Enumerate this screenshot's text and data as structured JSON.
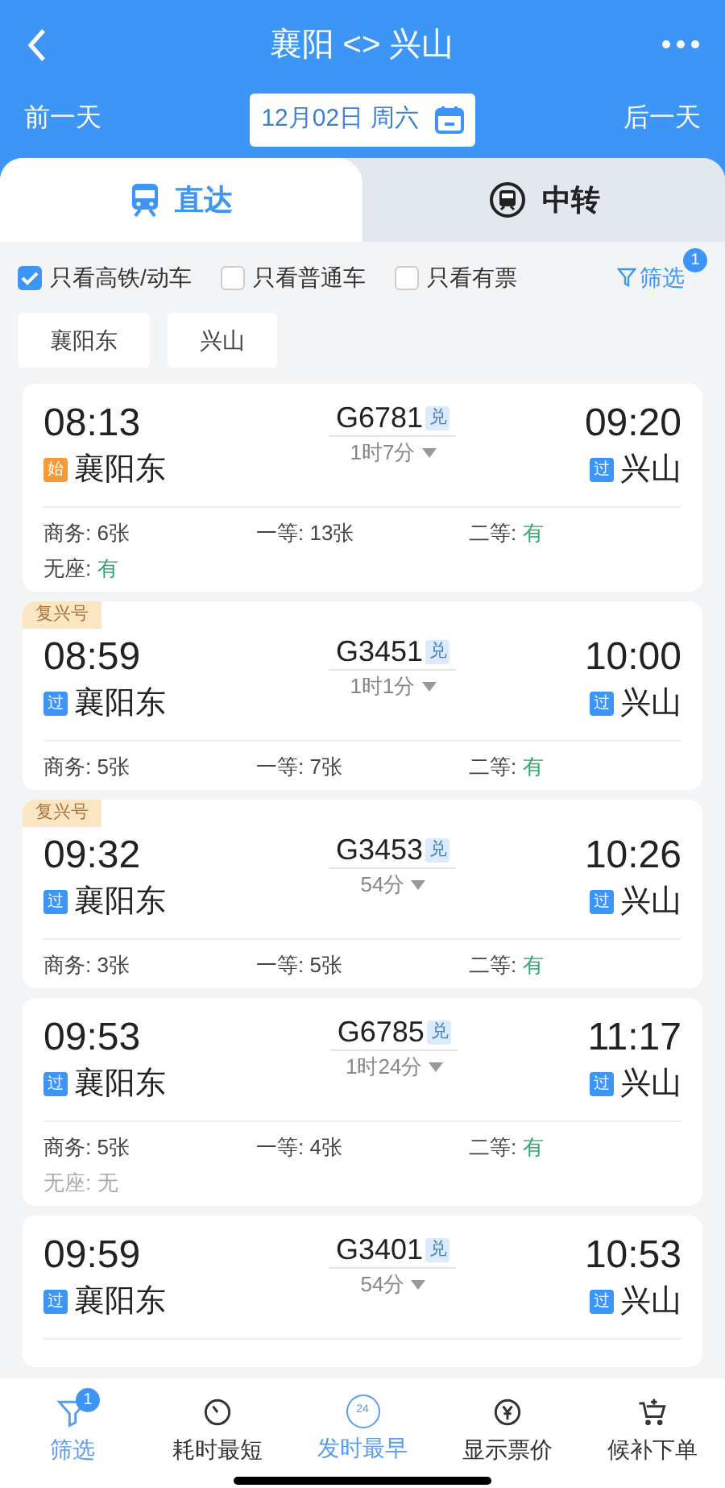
{
  "header": {
    "title": "襄阳 <> 兴山",
    "prev_day": "前一天",
    "date": "12月02日 周六",
    "next_day": "后一天"
  },
  "tabs": [
    {
      "label": "直达",
      "kind": "train",
      "selected": true
    },
    {
      "label": "中转",
      "kind": "transfer",
      "selected": false
    }
  ],
  "filters": [
    {
      "label": "只看高铁/动车",
      "checked": true
    },
    {
      "label": "只看普通车",
      "checked": false
    },
    {
      "label": "只看有票",
      "checked": false
    }
  ],
  "filter_button": {
    "label": "筛选",
    "badge": "1"
  },
  "station_chips": [
    "襄阳东",
    "兴山"
  ],
  "trains": [
    {
      "depart": "08:13",
      "number": "G6781",
      "tag": "兑",
      "duration": "1时7分",
      "arrive": "09:20",
      "from": {
        "tag": "始",
        "kind": "start",
        "name": "襄阳东"
      },
      "to": {
        "tag": "过",
        "kind": "pass",
        "name": "兴山"
      },
      "seats": [
        {
          "label": "商务:",
          "value": "6张",
          "kind": "count"
        },
        {
          "label": "一等:",
          "value": "13张",
          "kind": "count"
        },
        {
          "label": "二等:",
          "value": "有",
          "kind": "available"
        },
        {
          "label": "无座:",
          "value": "有",
          "kind": "available"
        }
      ]
    },
    {
      "badge": "复兴号",
      "depart": "08:59",
      "number": "G3451",
      "tag": "兑",
      "duration": "1时1分",
      "arrive": "10:00",
      "from": {
        "tag": "过",
        "kind": "pass",
        "name": "襄阳东"
      },
      "to": {
        "tag": "过",
        "kind": "pass",
        "name": "兴山"
      },
      "seats": [
        {
          "label": "商务:",
          "value": "5张",
          "kind": "count"
        },
        {
          "label": "一等:",
          "value": "7张",
          "kind": "count"
        },
        {
          "label": "二等:",
          "value": "有",
          "kind": "available"
        }
      ]
    },
    {
      "badge": "复兴号",
      "depart": "09:32",
      "number": "G3453",
      "tag": "兑",
      "duration": "54分",
      "arrive": "10:26",
      "from": {
        "tag": "过",
        "kind": "pass",
        "name": "襄阳东"
      },
      "to": {
        "tag": "过",
        "kind": "pass",
        "name": "兴山"
      },
      "seats": [
        {
          "label": "商务:",
          "value": "3张",
          "kind": "count"
        },
        {
          "label": "一等:",
          "value": "5张",
          "kind": "count"
        },
        {
          "label": "二等:",
          "value": "有",
          "kind": "available"
        }
      ]
    },
    {
      "depart": "09:53",
      "number": "G6785",
      "tag": "兑",
      "duration": "1时24分",
      "arrive": "11:17",
      "from": {
        "tag": "过",
        "kind": "pass",
        "name": "襄阳东"
      },
      "to": {
        "tag": "过",
        "kind": "pass",
        "name": "兴山"
      },
      "seats": [
        {
          "label": "商务:",
          "value": "5张",
          "kind": "count"
        },
        {
          "label": "一等:",
          "value": "4张",
          "kind": "count"
        },
        {
          "label": "二等:",
          "value": "有",
          "kind": "available"
        },
        {
          "label": "无座:",
          "value": "无",
          "kind": "none"
        }
      ]
    },
    {
      "depart": "09:59",
      "number": "G3401",
      "tag": "兑",
      "duration": "54分",
      "arrive": "10:53",
      "from": {
        "tag": "过",
        "kind": "pass",
        "name": "襄阳东"
      },
      "to": {
        "tag": "过",
        "kind": "pass",
        "name": "兴山"
      }
    }
  ],
  "bottom_nav": [
    {
      "kind": "filter",
      "label": "筛选",
      "badge": "1",
      "selected": true
    },
    {
      "kind": "timer",
      "label": "耗时最短",
      "selected": false
    },
    {
      "kind": "clock24",
      "label": "发时最早",
      "icon_text": "24",
      "selected": true
    },
    {
      "kind": "price",
      "label": "显示票价",
      "selected": false
    },
    {
      "kind": "cart",
      "label": "候补下单",
      "selected": false
    }
  ]
}
